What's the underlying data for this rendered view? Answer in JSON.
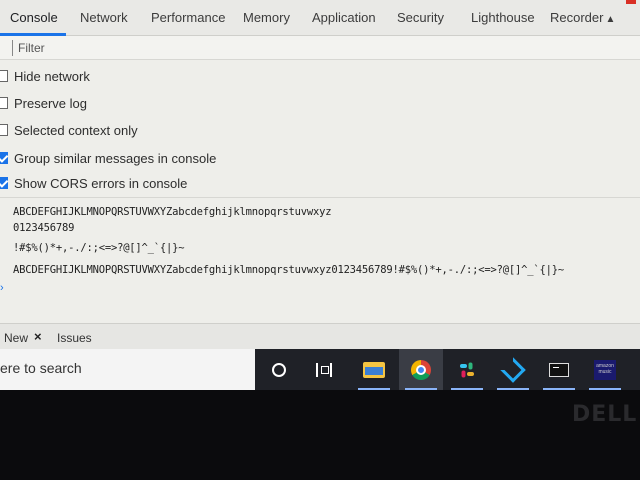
{
  "devtools": {
    "tabs": [
      {
        "label": "Console",
        "active": true
      },
      {
        "label": "Network"
      },
      {
        "label": "Performance"
      },
      {
        "label": "Memory"
      },
      {
        "label": "Application"
      },
      {
        "label": "Security"
      },
      {
        "label": "Lighthouse"
      },
      {
        "label": "Recorder",
        "icon": "flask-icon"
      }
    ],
    "filter": {
      "placeholder": "Filter"
    },
    "settings": [
      {
        "label": "Hide network",
        "checked": false
      },
      {
        "label": "Preserve log",
        "checked": false
      },
      {
        "label": "Selected context only",
        "checked": false
      },
      {
        "label": "Group similar messages in console",
        "checked": true
      },
      {
        "label": "Show CORS errors in console",
        "checked": true
      }
    ],
    "console_lines": [
      "ABCDEFGHIJKLMNOPQRSTUVWXYZabcdefghijklmnopqrstuvwxyz",
      "0123456789",
      "!#$%()*+,-./:;<=>?@[]^_`{|}~",
      "ABCDEFGHIJKLMNOPQRSTUVWXYZabcdefghijklmnopqrstuvwxyz0123456789!#$%()*+,-./:;<=>?@[]^_`{|}~"
    ],
    "prompt_symbol": "›",
    "drawer": {
      "tabs": [
        {
          "label": "New",
          "closable": true
        },
        {
          "label": "Issues"
        }
      ],
      "close_symbol": "×"
    },
    "accent_color": "#1a73e8"
  },
  "taskbar": {
    "search_text": "ere to search",
    "apps": [
      {
        "name": "cortana-icon"
      },
      {
        "name": "task-view-icon"
      },
      {
        "name": "file-explorer-icon"
      },
      {
        "name": "chrome-icon",
        "active": true
      },
      {
        "name": "slack-icon"
      },
      {
        "name": "vscode-icon"
      },
      {
        "name": "terminal-icon"
      },
      {
        "name": "amazon-music-icon",
        "text": "amazon music"
      }
    ]
  },
  "bezel": {
    "brand": "DELL"
  }
}
